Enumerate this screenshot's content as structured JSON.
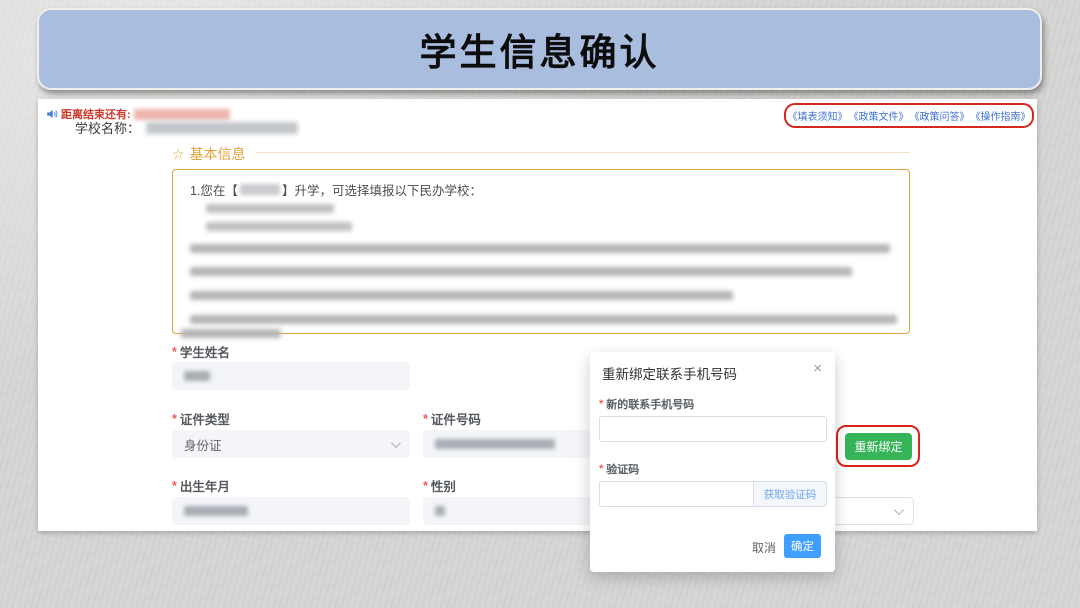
{
  "banner": {
    "title": "学生信息确认"
  },
  "header": {
    "countdown_label": "距离结束还有:",
    "school_label": "学校名称：",
    "links": [
      "《填表须知》",
      "《政策文件》",
      "《政策问答》",
      "《操作指南》"
    ]
  },
  "section": {
    "star": "☆",
    "title": "基本信息"
  },
  "notice": {
    "line1_prefix": "1.您在【",
    "line1_suffix": "】升学，可选择填报以下民办学校："
  },
  "form": {
    "required_mark": "*",
    "student_name_label": "学生姓名",
    "id_type_label": "证件类型",
    "id_type_value": "身份证",
    "id_number_label": "证件号码",
    "birth_label": "出生年月",
    "gender_label": "性别",
    "rebind_button_label": "重新绑定"
  },
  "modal": {
    "title": "重新绑定联系手机号码",
    "close_glyph": "×",
    "new_phone_label": "新的联系手机号码",
    "captcha_label": "验证码",
    "get_captcha_label": "获取验证码",
    "cancel_label": "取消",
    "confirm_label": "确定"
  },
  "colors": {
    "banner_blue": "#a9bddf",
    "accent_orange": "#e6a23c",
    "primary_blue": "#409eff",
    "success_green": "#35b558",
    "annotation_red": "#dd2317",
    "alert_red": "#cf382c",
    "link_blue": "#3d6fd0"
  }
}
